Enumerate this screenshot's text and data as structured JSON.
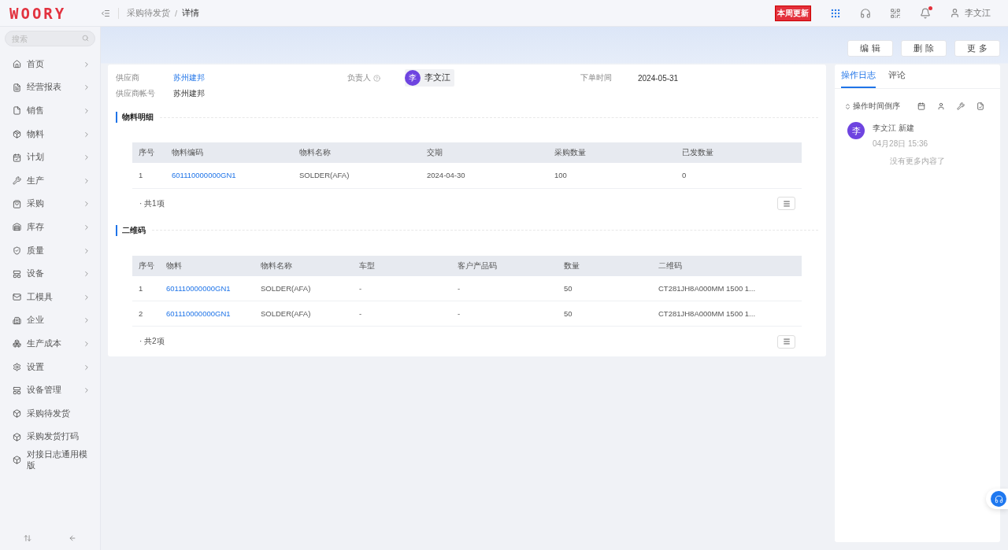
{
  "header": {
    "logo": "WOORY",
    "breadcrumb": [
      "采购待发货",
      "详情"
    ],
    "breadcrumb_separator": "/",
    "update_badge": "本周更新",
    "notifications_unread": true,
    "user": "李文江"
  },
  "sidebar": {
    "search": {
      "placeholder": "搜索"
    },
    "items": [
      {
        "label": "首页",
        "expandable": true
      },
      {
        "label": "经营报表",
        "expandable": true
      },
      {
        "label": "销售",
        "expandable": true
      },
      {
        "label": "物料",
        "expandable": true
      },
      {
        "label": "计划",
        "expandable": true
      },
      {
        "label": "生产",
        "expandable": true
      },
      {
        "label": "采购",
        "expandable": true
      },
      {
        "label": "库存",
        "expandable": true
      },
      {
        "label": "质量",
        "expandable": true
      },
      {
        "label": "设备",
        "expandable": true
      },
      {
        "label": "工模具",
        "expandable": true
      },
      {
        "label": "企业",
        "expandable": true
      },
      {
        "label": "生产成本",
        "expandable": true
      },
      {
        "label": "设置",
        "expandable": true
      },
      {
        "label": "设备管理",
        "expandable": true
      },
      {
        "label": "采购待发货",
        "expandable": false
      },
      {
        "label": "采购发货打码",
        "expandable": false
      },
      {
        "label": "对接日志通用模版",
        "expandable": false
      }
    ]
  },
  "actions": [
    "编 辑",
    "删 除",
    "更 多"
  ],
  "detail": {
    "fields": [
      {
        "label": "供应商",
        "value": "苏州建邦",
        "kind": "link"
      },
      {
        "label": "负责人",
        "value": "李文江",
        "kind": "person",
        "avatar": "李",
        "help": true
      },
      {
        "label": "下单时间",
        "value": "2024-05-31",
        "kind": "text"
      },
      {
        "label": "供应商帐号",
        "value": "苏州建邦",
        "kind": "text"
      }
    ],
    "sections": [
      {
        "title": "物料明细",
        "columns": [
          "序号",
          "物料编码",
          "物料名称",
          "交期",
          "采购数量",
          "已发数量"
        ],
        "rows": [
          [
            "1",
            "601110000000GN1",
            "SOLDER(AFA)",
            "2024-04-30",
            "100",
            "0"
          ]
        ],
        "total": "· 共1项"
      },
      {
        "title": "二维码",
        "columns": [
          "序号",
          "物料",
          "物料名称",
          "车型",
          "客户产品码",
          "数量",
          "二维码"
        ],
        "rows": [
          [
            "1",
            "601110000000GN1",
            "SOLDER(AFA)",
            "-",
            "-",
            "50",
            "CT281JH8A000MM 1500 1..."
          ],
          [
            "2",
            "601110000000GN1",
            "SOLDER(AFA)",
            "-",
            "-",
            "50",
            "CT281JH8A000MM 1500 1..."
          ]
        ],
        "total": "· 共2项"
      }
    ]
  },
  "log_panel": {
    "tabs": [
      {
        "label": "操作日志",
        "selected": true
      },
      {
        "label": "评论",
        "selected": false
      }
    ],
    "sort": "操作时间倒序",
    "entries": [
      {
        "avatar": "李",
        "text": "李文江 新建",
        "time": "04月28日 15:36"
      }
    ],
    "end_note": "没有更多内容了"
  }
}
